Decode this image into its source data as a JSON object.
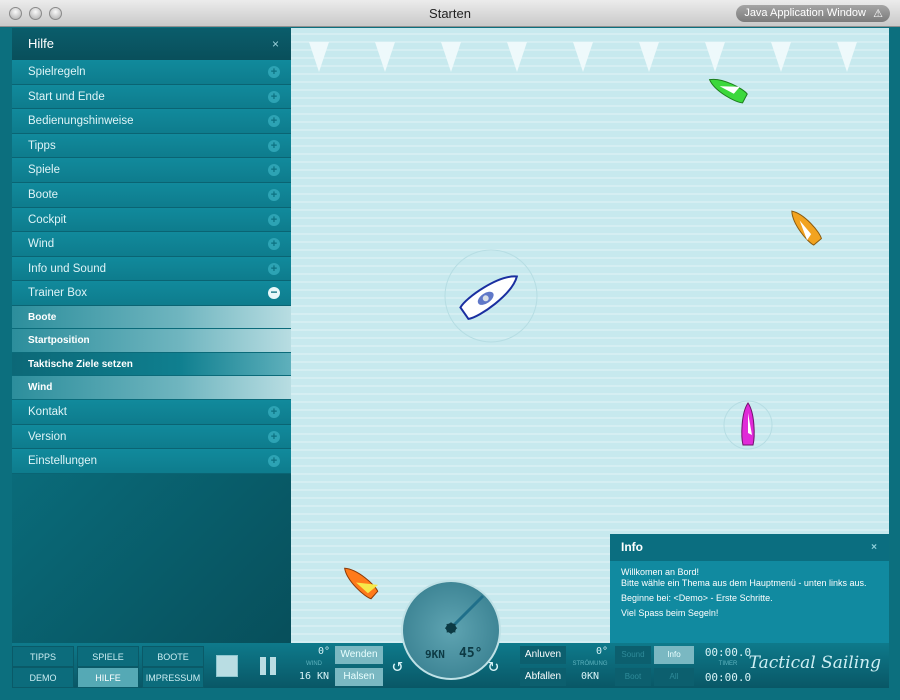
{
  "window": {
    "title": "Starten",
    "badge": "Java Application Window",
    "badge_icon": "warning-icon"
  },
  "sidebar": {
    "header": "Hilfe",
    "close": "×",
    "items": [
      {
        "label": "Spielregeln",
        "state": "collapsed"
      },
      {
        "label": "Start und Ende",
        "state": "collapsed"
      },
      {
        "label": "Bedienungshinweise",
        "state": "collapsed"
      },
      {
        "label": "Tipps",
        "state": "collapsed"
      },
      {
        "label": "Spiele",
        "state": "collapsed"
      },
      {
        "label": "Boote",
        "state": "collapsed"
      },
      {
        "label": "Cockpit",
        "state": "collapsed"
      },
      {
        "label": "Wind",
        "state": "collapsed"
      },
      {
        "label": "Info und Sound",
        "state": "collapsed"
      },
      {
        "label": "Trainer Box",
        "state": "expanded"
      }
    ],
    "subitems": [
      {
        "label": "Boote"
      },
      {
        "label": "Startposition"
      },
      {
        "label": "Taktische Ziele setzen"
      },
      {
        "label": "Wind"
      }
    ],
    "items_after": [
      {
        "label": "Kontakt"
      },
      {
        "label": "Version"
      },
      {
        "label": "Einstellungen"
      }
    ]
  },
  "info": {
    "title": "Info",
    "close": "×",
    "line1": "Willkomen an Bord!",
    "line2": "Bitte wähle ein Thema aus dem Hauptmenü - unten links aus.",
    "line3": "Beginne bei: <Demo> - Erste Schritte.",
    "line4": "Viel Spass beim Segeln!"
  },
  "bottom": {
    "nav": [
      "TIPPS",
      "SPIELE",
      "BOOTE",
      "DEMO",
      "HILFE",
      "IMPRESSUM"
    ],
    "active_nav": "HILFE",
    "wind_dir": "0°",
    "wind_label": "WIND",
    "wind_speed": "16 KN",
    "btn_wenden": "Wenden",
    "btn_halsen": "Halsen",
    "compass_speed": "9KN",
    "compass_angle": "45°",
    "btn_anluven": "Anluven",
    "btn_abfallen": "Abfallen",
    "current_dir": "0°",
    "current_label": "STRÖMUNG",
    "current_speed": "0KN",
    "btn_info": "Info",
    "btn_sound": "Sound",
    "btn_boot": "Boot",
    "btn_all": "All",
    "time1": "00:00.0",
    "timer_label": "TIMER",
    "time2": "00:00.0",
    "logo": "Tactical Sailing"
  }
}
